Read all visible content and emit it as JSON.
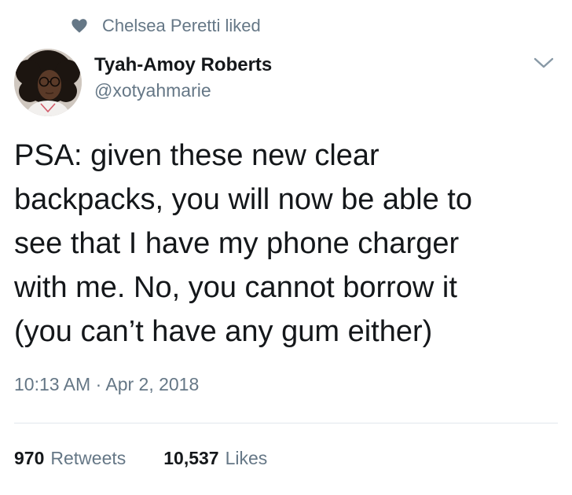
{
  "social_context": {
    "icon": "heart-icon",
    "text": "Chelsea Peretti liked"
  },
  "author": {
    "display_name": "Tyah-Amoy Roberts",
    "handle": "@xotyahmarie",
    "avatar": "profile-photo"
  },
  "tweet": {
    "lines": [
      "PSA: given these new clear",
      "backpacks, you will now be able to",
      "see that I have my phone charger",
      "with me. No, you cannot borrow it",
      "(you can’t have any gum either)"
    ],
    "timestamp": "10:13 AM · Apr 2, 2018"
  },
  "stats": {
    "retweets_count": "970",
    "retweets_label": "Retweets",
    "likes_count": "10,537",
    "likes_label": "Likes"
  },
  "colors": {
    "primary_text": "#14171a",
    "secondary_text": "#657786",
    "divider": "#e1e8ed",
    "icon_gray": "#657786"
  }
}
